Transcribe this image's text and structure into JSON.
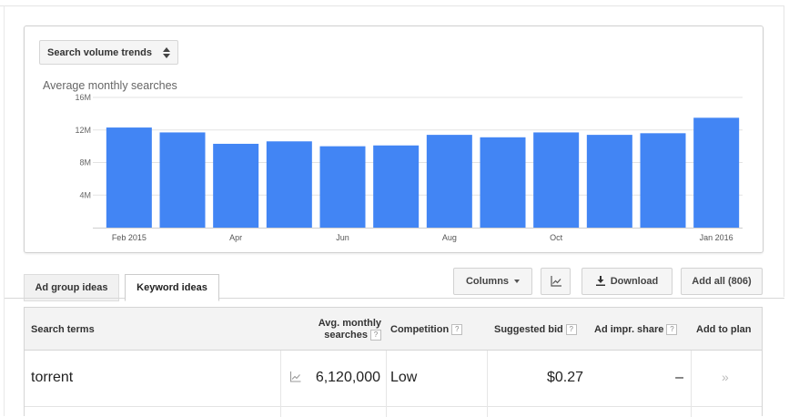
{
  "trend_selector": {
    "label": "Search volume trends"
  },
  "chart_data": {
    "type": "bar",
    "title": "Average monthly searches",
    "y_ticks": [
      "16M",
      "12M",
      "8M",
      "4M"
    ],
    "ylim": [
      0,
      16000000
    ],
    "x_labels": [
      "Feb 2015",
      "Apr",
      "Jun",
      "Aug",
      "Oct",
      "Jan 2016"
    ],
    "categories": [
      "Feb 2015",
      "Mar 2015",
      "Apr 2015",
      "May 2015",
      "Jun 2015",
      "Jul 2015",
      "Aug 2015",
      "Sep 2015",
      "Oct 2015",
      "Nov 2015",
      "Dec 2015",
      "Jan 2016"
    ],
    "values": [
      12300000,
      11700000,
      10300000,
      10600000,
      10000000,
      10100000,
      11400000,
      11100000,
      11700000,
      11400000,
      11600000,
      13500000
    ],
    "color": "#4285f4",
    "grid": true
  },
  "tabs": [
    {
      "label": "Ad group ideas",
      "active": false
    },
    {
      "label": "Keyword ideas",
      "active": true
    }
  ],
  "toolbar": {
    "columns_label": "Columns",
    "download_label": "Download",
    "add_all_label": "Add all (806)"
  },
  "table": {
    "headers": {
      "search_terms": "Search terms",
      "avg_line1": "Avg. monthly",
      "avg_line2": "searches",
      "competition": "Competition",
      "suggested_bid": "Suggested bid",
      "ad_impr_share": "Ad impr. share",
      "add_to_plan": "Add to plan",
      "help": "?"
    },
    "rows": [
      {
        "term": "torrent",
        "avg_monthly_searches": "6,120,000",
        "competition": "Low",
        "suggested_bid": "$0.27",
        "ad_impr_share": "–",
        "add": "»"
      }
    ]
  }
}
